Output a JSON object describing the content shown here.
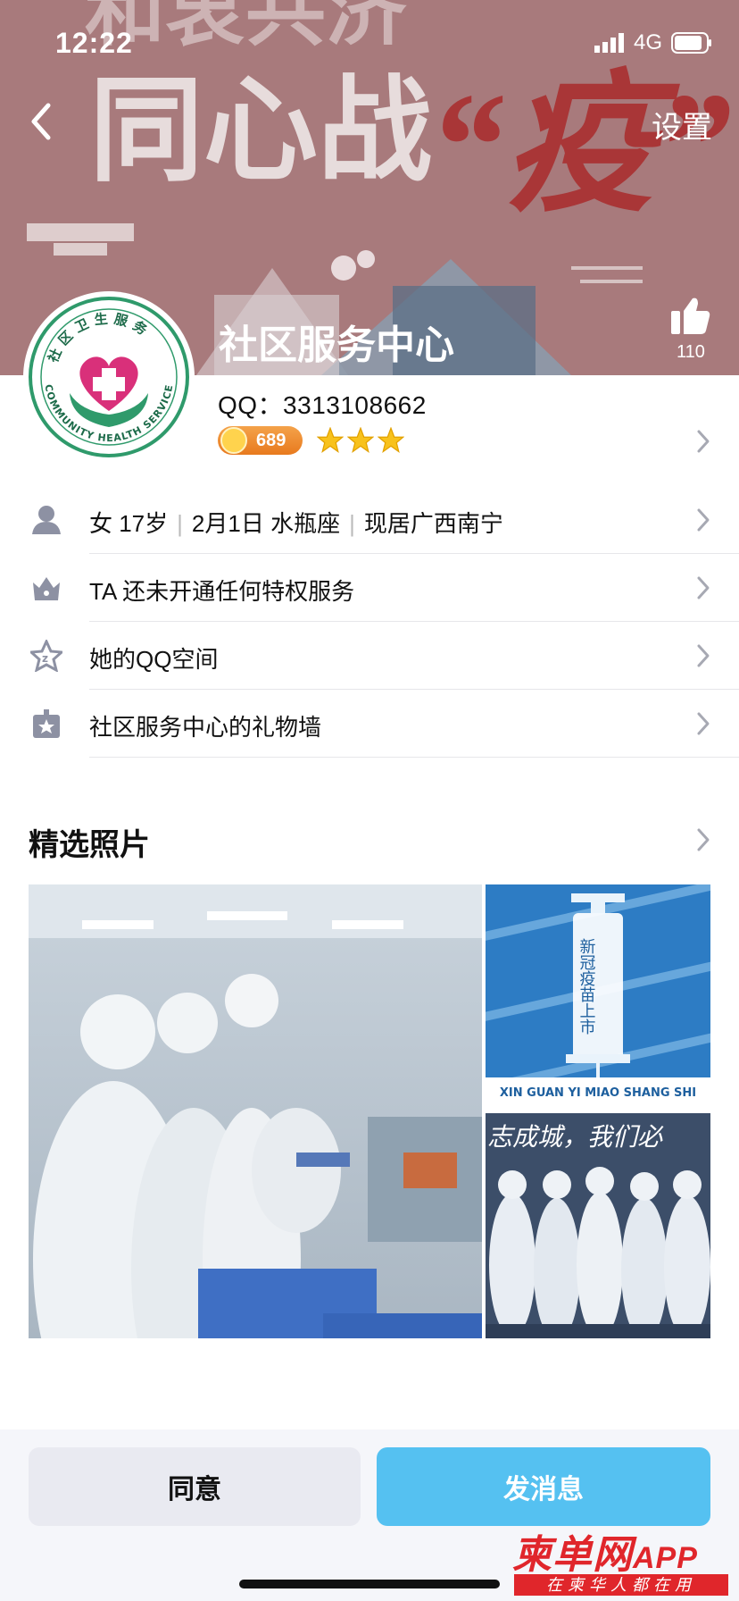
{
  "status_bar": {
    "time": "12:22",
    "network": "4G"
  },
  "header": {
    "back_icon": "chevron-left-icon",
    "settings_label": "设置",
    "cover_lines": [
      "和衷共济",
      "同心战",
      "“疫”"
    ],
    "like_count": "110"
  },
  "profile": {
    "name": "社区服务中心",
    "qq_line": "QQ：3313108662",
    "coin_value": "689",
    "star_count": 3,
    "avatar_top_text": "社区卫生服务",
    "avatar_bottom_text": "COMMUNITY HEALTH SERVICE"
  },
  "info_rows": [
    {
      "icon": "person-icon",
      "gender_age": "女 17岁",
      "birthday": "2月1日 水瓶座",
      "location": "现居广西南宁"
    },
    {
      "icon": "crown-icon",
      "label": "TA 还未开通任何特权服务"
    },
    {
      "icon": "qzone-star-icon",
      "label": "她的QQ空间"
    },
    {
      "icon": "gift-icon",
      "label": "社区服务中心的礼物墙"
    }
  ],
  "photos_section": {
    "title": "精选照片",
    "photo_texts": {
      "vaccine_vertical": "新冠疫苗上市",
      "vaccine_pinyin": "XIN GUAN YI MIAO SHANG SHI",
      "team_banner": "志成城，我们必"
    }
  },
  "actions": {
    "agree_label": "同意",
    "message_label": "发消息"
  },
  "watermark": {
    "title": "柬单网",
    "app": "APP",
    "subtitle": "在柬华人都在用"
  },
  "colors": {
    "accent_blue": "#55c1f1",
    "cover_bg": "#a67577",
    "watermark_red": "#e0262b"
  }
}
